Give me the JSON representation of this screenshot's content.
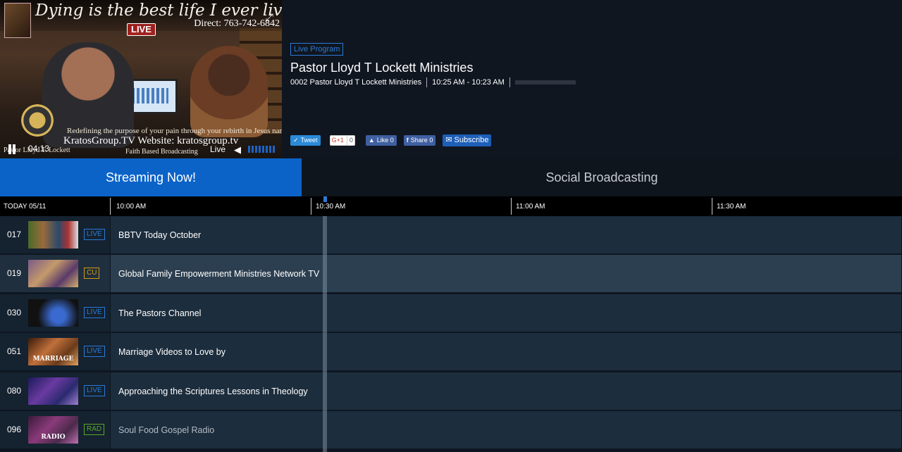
{
  "video": {
    "overlay_script": "Dying is the best life I ever lived",
    "overlay_phone": "Direct: 763-742-6842",
    "overlay_badge": "LIVE",
    "overlay_tagline": "Redefining the purpose of your pain through your rebirth in Jesus name.",
    "overlay_site": "KratosGroup.TV   Website: kratosgroup.tv",
    "overlay_faith": "Faith Based Broadcasting",
    "overlay_name": "Pastor Lloyd T. Lockett",
    "timecode": "04:13",
    "live_label": "Live",
    "icons": {
      "pause": "pause-icon",
      "volume": "volume-icon",
      "fullscreen": "fullscreen-icon"
    }
  },
  "program": {
    "tag": "Live Program",
    "title": "Pastor Lloyd T Lockett Ministries",
    "meta_channel": "0002 Pastor Lloyd T Lockett Ministries",
    "meta_time": "10:25 AM - 10:23 AM",
    "progress": 0
  },
  "social": {
    "tweet": "Tweet",
    "gplus": "G+1",
    "gplus_count": "0",
    "like": "Like 0",
    "share": "Share 0",
    "subscribe": "Subscribe"
  },
  "tabs": [
    {
      "label": "Streaming Now!",
      "active": true
    },
    {
      "label": "Social Broadcasting",
      "active": false
    }
  ],
  "timeline": {
    "today": "TODAY 05/11",
    "slots": [
      "10:00 AM",
      "10:30 AM",
      "11:00 AM",
      "11:30 AM"
    ]
  },
  "channels": [
    {
      "number": "017",
      "badge": "LIVE",
      "badge_type": "live",
      "program": "BBTV Today October",
      "thumb_caption": ""
    },
    {
      "number": "019",
      "badge": "CU",
      "badge_type": "cu",
      "program": "Global Family Empowerment Ministries Network TV",
      "thumb_caption": ""
    },
    {
      "number": "030",
      "badge": "LIVE",
      "badge_type": "live",
      "program": "The Pastors Channel",
      "thumb_caption": ""
    },
    {
      "number": "051",
      "badge": "LIVE",
      "badge_type": "live",
      "program": "Marriage Videos to Love by",
      "thumb_caption": "MARRIAGE"
    },
    {
      "number": "080",
      "badge": "LIVE",
      "badge_type": "live",
      "program": "Approaching the Scriptures Lessons in Theology",
      "thumb_caption": ""
    },
    {
      "number": "096",
      "badge": "RAD",
      "badge_type": "rad",
      "program": "Soul Food Gospel Radio",
      "thumb_caption": "RADIO"
    }
  ],
  "colors": {
    "accent": "#0b63c8",
    "live": "#2b7bd6",
    "cu": "#d19b12",
    "rad": "#5aa82c",
    "background": "#0e1621"
  }
}
